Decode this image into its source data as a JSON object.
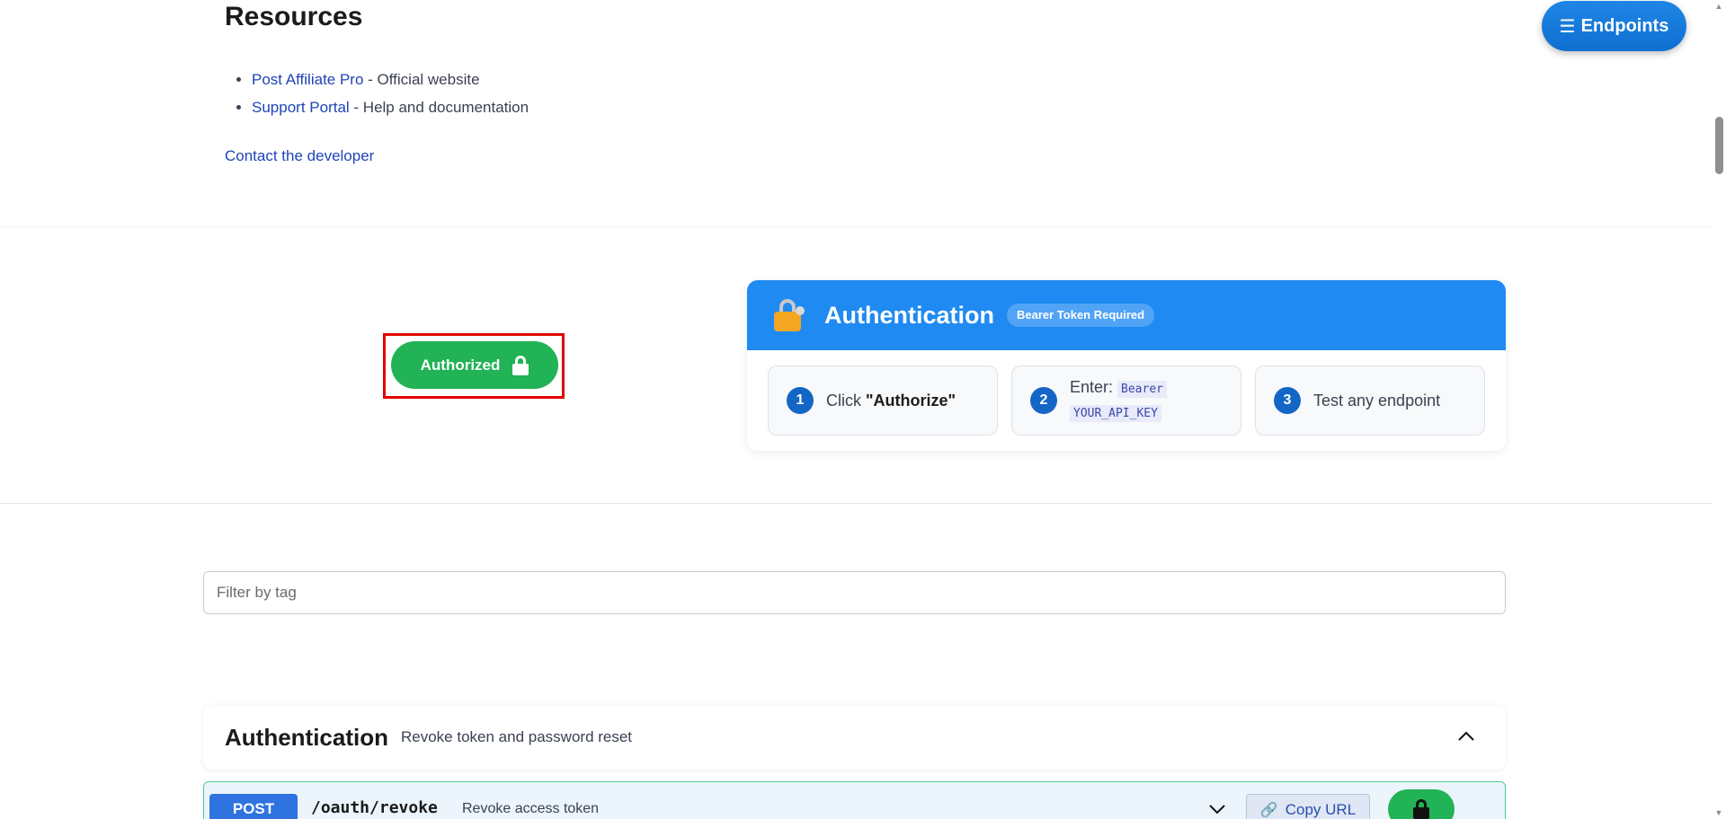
{
  "floating": {
    "endpoints_label": "Endpoints",
    "endpoints_icon": "menu-icon"
  },
  "resources": {
    "title": "Resources",
    "items": [
      {
        "link": "Post Affiliate Pro",
        "text": " - Official website"
      },
      {
        "link": "Support Portal",
        "text": " - Help and documentation"
      }
    ],
    "contact": "Contact the developer"
  },
  "scheme": {
    "authorize_label": "Authorized",
    "authorize_icon": "lock-icon"
  },
  "auth_card": {
    "title": "Authentication",
    "badge": "Bearer Token Required",
    "steps": [
      {
        "num": "1",
        "prefix": "Click ",
        "bold": "\"Authorize\""
      },
      {
        "num": "2",
        "prefix": "Enter: ",
        "code_a": "Bearer",
        "code_b": "YOUR_API_KEY"
      },
      {
        "num": "3",
        "text": "Test any endpoint"
      }
    ]
  },
  "filter": {
    "placeholder": "Filter by tag",
    "value": ""
  },
  "tag_section": {
    "title": "Authentication",
    "description": "Revoke token and password reset"
  },
  "operation": {
    "method": "POST",
    "path": "/oauth/revoke",
    "summary": "Revoke access token",
    "copy_label": "Copy URL"
  },
  "colors": {
    "accent": "#1f8af2",
    "authorized": "#21b356",
    "post": "#2f73e0",
    "highlight": "#e20000"
  }
}
